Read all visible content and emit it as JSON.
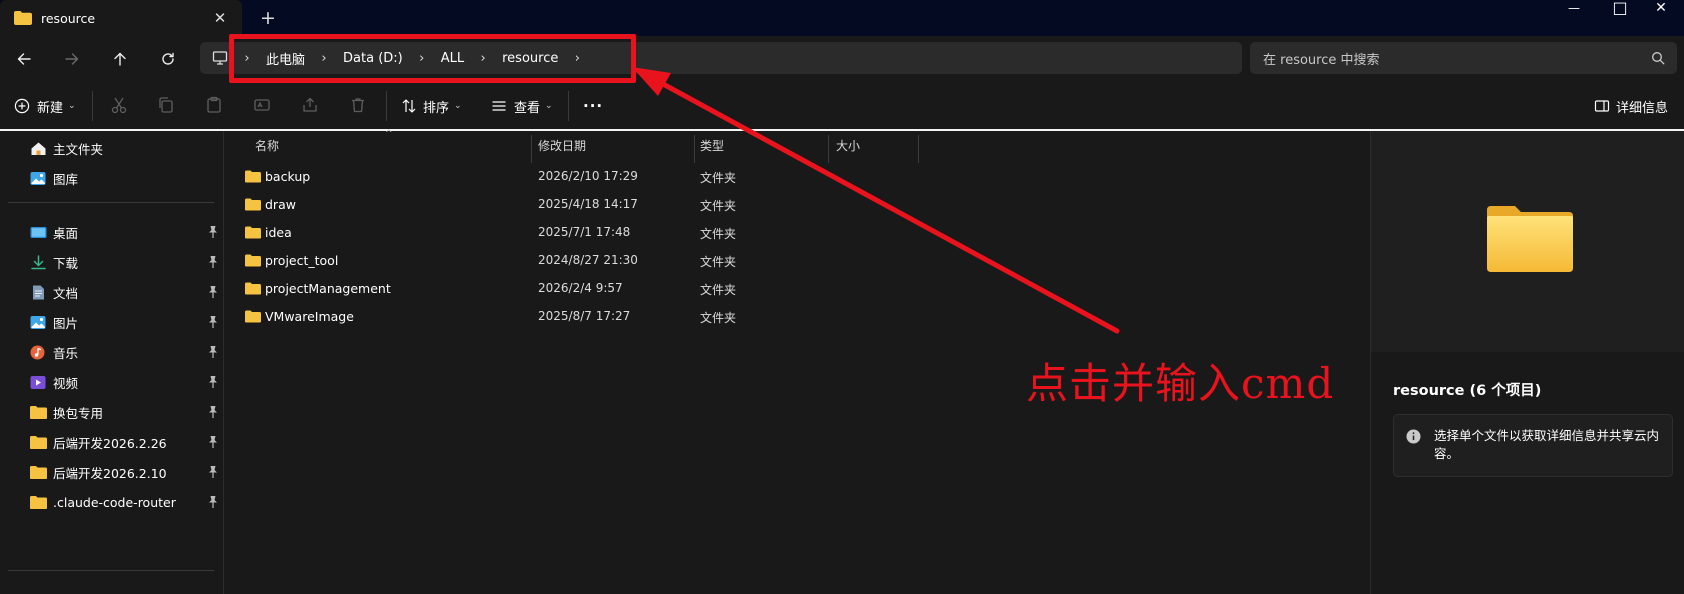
{
  "window": {
    "tab_title": "resource",
    "tab_close": "✕",
    "new_tab": "+",
    "minimize": "—",
    "maximize": "□",
    "close": "✕"
  },
  "nav": {
    "back_icon": "arrow-left-icon",
    "forward_icon": "arrow-right-icon",
    "up_icon": "arrow-up-icon",
    "refresh_icon": "refresh-icon",
    "breadcrumb": [
      "此电脑",
      "Data (D:)",
      "ALL",
      "resource"
    ],
    "separator": "›",
    "search_placeholder": "在 resource 中搜索"
  },
  "toolbar": {
    "new_label": "新建",
    "sort_label": "排序",
    "view_label": "查看",
    "more_label": "···",
    "details_label": "详细信息",
    "caret": "⌄"
  },
  "sidebar": {
    "top_items": [
      {
        "label": "主文件夹",
        "icon": "home-icon"
      },
      {
        "label": "图库",
        "icon": "gallery-icon"
      }
    ],
    "pinned_items": [
      {
        "label": "桌面",
        "icon": "desktop-icon"
      },
      {
        "label": "下载",
        "icon": "download-icon"
      },
      {
        "label": "文档",
        "icon": "document-icon"
      },
      {
        "label": "图片",
        "icon": "pictures-icon"
      },
      {
        "label": "音乐",
        "icon": "music-icon"
      },
      {
        "label": "视频",
        "icon": "video-icon"
      },
      {
        "label": "换包专用",
        "icon": "folder-icon"
      },
      {
        "label": "后端开发2026.2.26",
        "icon": "folder-icon"
      },
      {
        "label": "后端开发2026.2.10",
        "icon": "folder-icon"
      },
      {
        "label": ".claude-code-router",
        "icon": "folder-icon"
      }
    ]
  },
  "list": {
    "columns": [
      "名称",
      "修改日期",
      "类型",
      "大小"
    ],
    "rows": [
      {
        "name": "backup",
        "date": "2026/2/10 17:29",
        "type": "文件夹"
      },
      {
        "name": "draw",
        "date": "2025/4/18 14:17",
        "type": "文件夹"
      },
      {
        "name": "idea",
        "date": "2025/7/1 17:48",
        "type": "文件夹"
      },
      {
        "name": "project_tool",
        "date": "2024/8/27 21:30",
        "type": "文件夹"
      },
      {
        "name": "projectManagement",
        "date": "2026/2/4 9:57",
        "type": "文件夹"
      },
      {
        "name": "VMwareImage",
        "date": "2025/8/7 17:27",
        "type": "文件夹"
      }
    ]
  },
  "details": {
    "title": "resource (6 个项目)",
    "info_text": "选择单个文件以获取详细信息并共享云内容。"
  },
  "annotation": {
    "text": "点击并输入cmd",
    "color": "#e8131d"
  },
  "colors": {
    "folder": "#f5c242",
    "titlebar": "#040a22",
    "background": "#191919"
  }
}
